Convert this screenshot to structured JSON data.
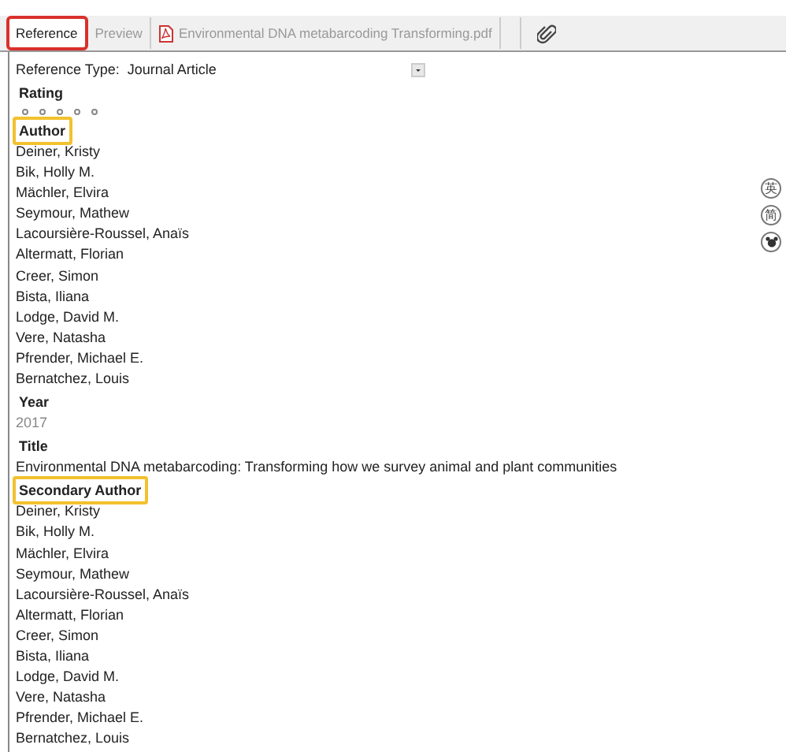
{
  "tabs": [
    {
      "label": "Reference",
      "selected": true,
      "highlighted": true,
      "kind": "text"
    },
    {
      "label": "Preview",
      "selected": false,
      "highlighted": false,
      "kind": "text"
    },
    {
      "label": "Environmental DNA metabarcoding  Transforming.pdf",
      "selected": false,
      "highlighted": false,
      "kind": "pdf"
    }
  ],
  "reference_type": {
    "label": "Reference Type:",
    "value": "Journal Article"
  },
  "rating": {
    "label": "Rating",
    "stars": 0
  },
  "sections": [
    {
      "label": "Author",
      "highlighted": true,
      "dimmed": false,
      "lines": [
        "Deiner, Kristy",
        "Bik, Holly M.",
        "Mächler, Elvira",
        "Seymour, Mathew",
        "Lacoursière-Roussel, Anaïs",
        "Altermatt, Florian",
        "Creer, Simon",
        "Bista, Iliana",
        "Lodge, David M.",
        "Vere, Natasha",
        "Pfrender, Michael E.",
        "Bernatchez, Louis"
      ]
    },
    {
      "label": "Year",
      "highlighted": false,
      "dimmed": true,
      "lines": [
        "2017"
      ]
    },
    {
      "label": "Title",
      "highlighted": false,
      "dimmed": false,
      "lines": [
        "Environmental DNA metabarcoding: Transforming how we survey animal and plant communities"
      ]
    },
    {
      "label": "Secondary Author",
      "highlighted": true,
      "dimmed": false,
      "lines": [
        "Deiner, Kristy",
        "Bik, Holly M.",
        "Mächler, Elvira",
        "Seymour, Mathew",
        "Lacoursière-Roussel, Anaïs",
        "Altermatt, Florian",
        "Creer, Simon",
        "Bista, Iliana",
        "Lodge, David M.",
        "Vere, Natasha",
        "Pfrender, Michael E.",
        "Bernatchez, Louis"
      ]
    }
  ],
  "side_buttons": [
    {
      "kind": "text",
      "label": "英"
    },
    {
      "kind": "text",
      "label": "简"
    },
    {
      "kind": "icon"
    }
  ]
}
